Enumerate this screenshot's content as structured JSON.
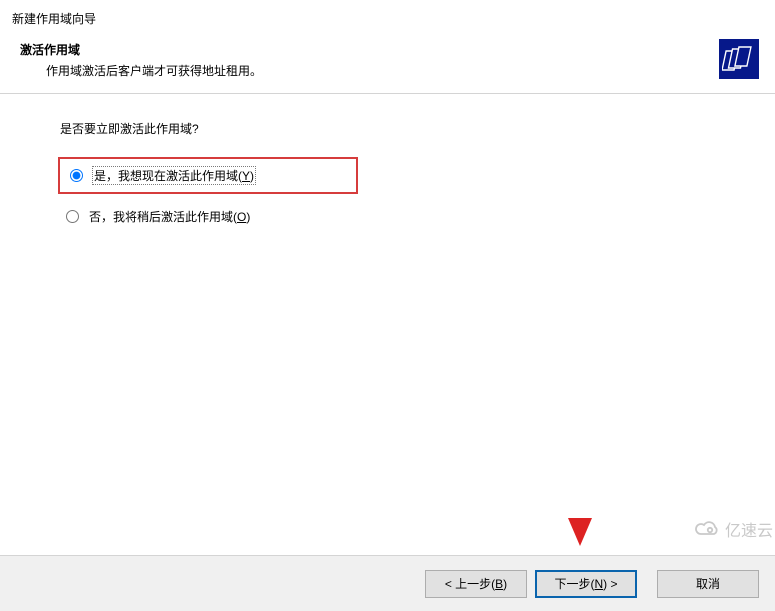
{
  "window": {
    "title": "新建作用域向导"
  },
  "header": {
    "title": "激活作用域",
    "description": "作用域激活后客户端才可获得地址租用。"
  },
  "content": {
    "question": "是否要立即激活此作用域?",
    "options": {
      "yes": {
        "prefix": "是，我想现在激活此作用域(",
        "accel": "Y",
        "suffix": ")",
        "selected": true
      },
      "no": {
        "prefix": "否，我将稍后激活此作用域(",
        "accel": "O",
        "suffix": ")",
        "selected": false
      }
    }
  },
  "footer": {
    "back": {
      "pre": "< 上一步(",
      "accel": "B",
      "post": ")"
    },
    "next": {
      "pre": "下一步(",
      "accel": "N",
      "post": ") >"
    },
    "cancel": {
      "label": "取消"
    }
  },
  "watermark": {
    "text": "亿速云"
  }
}
